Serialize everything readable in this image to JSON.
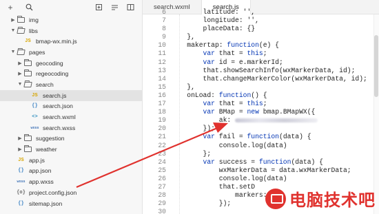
{
  "toolbar": {
    "add_icon": "plus",
    "search_icon": "search",
    "new_file_icon": "new-file",
    "collapse_icon": "collapse",
    "split_icon": "split"
  },
  "tree": [
    {
      "label": "img",
      "type": "folder",
      "state": "closed",
      "depth": 0
    },
    {
      "label": "libs",
      "type": "folder",
      "state": "open",
      "depth": 0
    },
    {
      "label": "bmap-wx.min.js",
      "type": "js",
      "depth": 1
    },
    {
      "label": "pages",
      "type": "folder",
      "state": "open",
      "depth": 0
    },
    {
      "label": "geocoding",
      "type": "folder",
      "state": "closed",
      "depth": 1
    },
    {
      "label": "regeocoding",
      "type": "folder",
      "state": "closed",
      "depth": 1
    },
    {
      "label": "search",
      "type": "folder",
      "state": "open",
      "depth": 1
    },
    {
      "label": "search.js",
      "type": "js",
      "depth": 2,
      "selected": true
    },
    {
      "label": "search.json",
      "type": "json",
      "depth": 2
    },
    {
      "label": "search.wxml",
      "type": "wxml",
      "depth": 2
    },
    {
      "label": "search.wxss",
      "type": "wxss",
      "depth": 2
    },
    {
      "label": "suggestion",
      "type": "folder",
      "state": "closed",
      "depth": 1
    },
    {
      "label": "weather",
      "type": "folder",
      "state": "closed",
      "depth": 1
    },
    {
      "label": "app.js",
      "type": "js",
      "depth": 0
    },
    {
      "label": "app.json",
      "type": "json",
      "depth": 0
    },
    {
      "label": "app.wxss",
      "type": "wxss",
      "depth": 0
    },
    {
      "label": "project.config.json",
      "type": "cfg",
      "depth": 0
    },
    {
      "label": "sitemap.json",
      "type": "json",
      "depth": 0
    }
  ],
  "icon_glyphs": {
    "js": "JS",
    "json": "{}",
    "wxml": "<>",
    "wxss": "wxss",
    "cfg": "{o}"
  },
  "tabs": [
    {
      "label": "search.wxml",
      "active": false
    },
    {
      "label": "search.js",
      "active": true
    }
  ],
  "code_lines": [
    {
      "n": "6",
      "text": "        latitude: '',"
    },
    {
      "n": "7",
      "text": "        longitude: '',"
    },
    {
      "n": "8",
      "text": "        placeData: {}"
    },
    {
      "n": "9",
      "text": "    },"
    },
    {
      "n": "10",
      "text": "    makertap: function(e) {"
    },
    {
      "n": "11",
      "text": "        var that = this;"
    },
    {
      "n": "12",
      "text": "        var id = e.markerId;"
    },
    {
      "n": "13",
      "text": "        that.showSearchInfo(wxMarkerData, id);"
    },
    {
      "n": "14",
      "text": "        that.changeMarkerColor(wxMarkerData, id);"
    },
    {
      "n": "15",
      "text": "    },"
    },
    {
      "n": "16",
      "text": "    onLoad: function() {"
    },
    {
      "n": "17",
      "text": "        var that = this;"
    },
    {
      "n": "18",
      "text": "        var BMap = new bmap.BMapWX({"
    },
    {
      "n": "19",
      "text": "            ak: ",
      "redacted": true
    },
    {
      "n": "20",
      "text": "        });"
    },
    {
      "n": "21",
      "text": "        var fail = function(data) {"
    },
    {
      "n": "22",
      "text": "            console.log(data)"
    },
    {
      "n": "23",
      "text": "        };"
    },
    {
      "n": "24",
      "text": "        var success = function(data) {"
    },
    {
      "n": "25",
      "text": "            wxMarkerData = data.wxMarkerData;"
    },
    {
      "n": "26",
      "text": "            console.log(data)"
    },
    {
      "n": "27",
      "text": "            that.setD"
    },
    {
      "n": "28",
      "text": "                markers: wxM"
    },
    {
      "n": "29",
      "text": "            });"
    },
    {
      "n": "30",
      "text": ""
    }
  ],
  "watermark": {
    "text": "电脑技术吧",
    "accent": "#e0322e"
  },
  "colors": {
    "keyword": "#0033b3",
    "arrow": "#e0322e",
    "selected_row": "#e3e3e3"
  }
}
